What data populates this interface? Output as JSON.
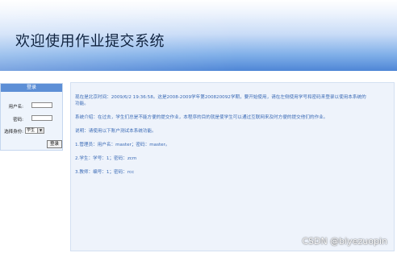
{
  "header": {
    "title": "欢迎使用作业提交系统"
  },
  "login": {
    "header": "登录",
    "username_label": "用户名:",
    "username_value": "",
    "password_label": "密码:",
    "password_value": "",
    "role_label": "选择身份:",
    "role_selected": "学生",
    "submit_label": "登录"
  },
  "content": {
    "line1": "现在是北京时间：2009/6/2 19:36:58。这是2008-2009学年第200820092学期，要开始使用，请在左侧使用学号和密码来登录以使用本系统的",
    "line1b": "功能。",
    "line2": "系统介绍：在过去，学生们总是不能方便的提交作业，本程序的目的就是使学生可以通过互联网来及时方便的提交他们的作业。",
    "line3": "说明：请使用以下账户测试本系统功能。",
    "account1": "1.管理员：用户名：master；密码：master。",
    "account2": "2.学生：学号：1；密码：zcm",
    "account3": "3.教师：编号：1；密码：rcc"
  },
  "watermark": "CSDN @biyezuopin",
  "colors": {
    "banner_top": "#ffffff",
    "banner_bottom": "#4f86d6",
    "login_header": "#5d8fd6",
    "content_bg": "#eef3fb",
    "content_text": "#3a6ab5"
  }
}
